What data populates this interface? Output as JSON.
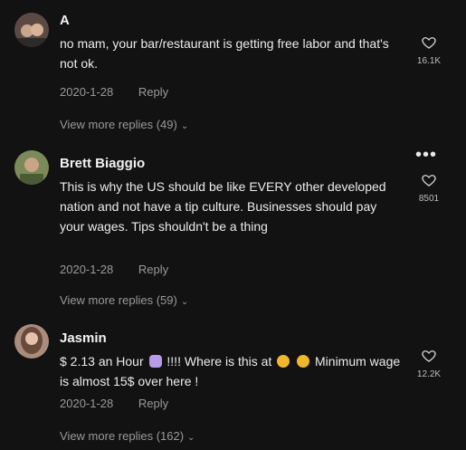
{
  "colors": {
    "background": "#121212",
    "text": "#ececec",
    "muted": "#9a9a9a"
  },
  "comments": [
    {
      "username": "A",
      "text": "no mam, your bar/restaurant is getting free labor and that's not ok.",
      "date": "2020-1-28",
      "reply": "Reply",
      "view_more": "View more replies (49)",
      "likes": "16.1K"
    },
    {
      "username": "Brett Biaggio",
      "text": "This is why the US should be like EVERY other developed nation and not have a tip culture. Businesses should pay your wages. Tips shouldn't be a thing",
      "date": "2020-1-28",
      "reply": "Reply",
      "view_more": "View more replies (59)",
      "likes": "8501",
      "more": "•••"
    },
    {
      "username": "Jasmin",
      "text_part1": "$ 2.13 an Hour",
      "text_part2": "!!!! Where is this at",
      "text_part3": "Minimum wage is almost 15$ over here !",
      "date": "2020-1-28",
      "reply": "Reply",
      "view_more": "View more replies (162)",
      "likes": "12.2K"
    }
  ]
}
